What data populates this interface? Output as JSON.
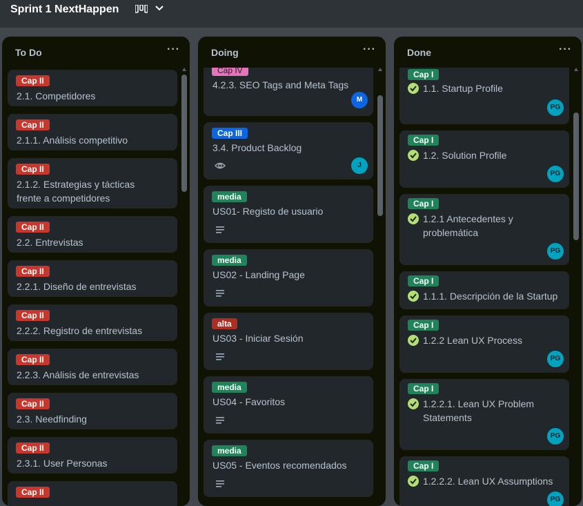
{
  "board": {
    "title": "Sprint 1 NextHappen",
    "view_icon": "board-view-icon",
    "menu_icon": "chevron-down-icon"
  },
  "colors": {
    "label_red": "#c9372c",
    "label_red_dark": "#ae2e24",
    "label_green": "#1f845a",
    "label_blue": "#0c66e4",
    "label_pink": "#e774bb",
    "avatar_blue": "#0c66e4",
    "avatar_teal": "#00a3bf",
    "check_green": "#b3df72"
  },
  "columns": [
    {
      "title": "To Do",
      "more": "···",
      "cards": [
        {
          "label": "Cap II",
          "title": "2.1. Competidores"
        },
        {
          "label": "Cap II",
          "title": "2.1.1. Análisis competitivo"
        },
        {
          "label": "Cap II",
          "title": "2.1.2. Estrategias y tácticas frente a competidores"
        },
        {
          "label": "Cap II",
          "title": "2.2. Entrevistas"
        },
        {
          "label": "Cap II",
          "title": "2.2.1. Diseño de entrevistas"
        },
        {
          "label": "Cap II",
          "title": "2.2.2. Registro de entrevistas"
        },
        {
          "label": "Cap II",
          "title": "2.2.3. Análisis de entrevistas"
        },
        {
          "label": "Cap II",
          "title": "2.3. Needfinding"
        },
        {
          "label": "Cap II",
          "title": "2.3.1. User Personas"
        },
        {
          "label": "Cap II",
          "title": ""
        }
      ]
    },
    {
      "title": "Doing",
      "more": "···",
      "cards": [
        {
          "label": "Cap IV",
          "title": "4.2.3. SEO Tags and Meta Tags",
          "avatar": "M"
        },
        {
          "label": "Cap III",
          "title": "3.4. Product Backlog",
          "avatar": "J",
          "icon": "eye-icon"
        },
        {
          "label": "media",
          "title": "US01- Registo de usuario",
          "icon": "description-icon"
        },
        {
          "label": "media",
          "title": "US02 - Landing Page",
          "icon": "description-icon"
        },
        {
          "label": "alta",
          "title": "US03 - Iniciar Sesión",
          "icon": "description-icon"
        },
        {
          "label": "media",
          "title": "US04 - Favoritos",
          "icon": "description-icon"
        },
        {
          "label": "media",
          "title": "US05 - Eventos recomendados",
          "icon": "description-icon"
        }
      ]
    },
    {
      "title": "Done",
      "more": "···",
      "cards": [
        {
          "label": "Cap I",
          "title": "1.1. Startup Profile",
          "avatar": "PG",
          "done": "check-icon"
        },
        {
          "label": "Cap I",
          "title": "1.2. Solution Profile",
          "avatar": "PG",
          "done": "check-icon"
        },
        {
          "label": "Cap I",
          "title": "1.2.1 Antecedentes y problemática",
          "avatar": "PG",
          "done": "check-icon"
        },
        {
          "label": "Cap I",
          "title": "1.1.1. Descripción de la Startup",
          "done": "check-icon"
        },
        {
          "label": "Cap I",
          "title": "1.2.2 Lean UX Process",
          "avatar": "PG",
          "done": "check-icon"
        },
        {
          "label": "Cap I",
          "title": "1.2.2.1. Lean UX Problem Statements",
          "avatar": "PG",
          "done": "check-icon"
        },
        {
          "label": "Cap I",
          "title": "1.2.2.2. Lean UX Assumptions",
          "avatar": "PG",
          "done": "check-icon"
        }
      ]
    }
  ]
}
